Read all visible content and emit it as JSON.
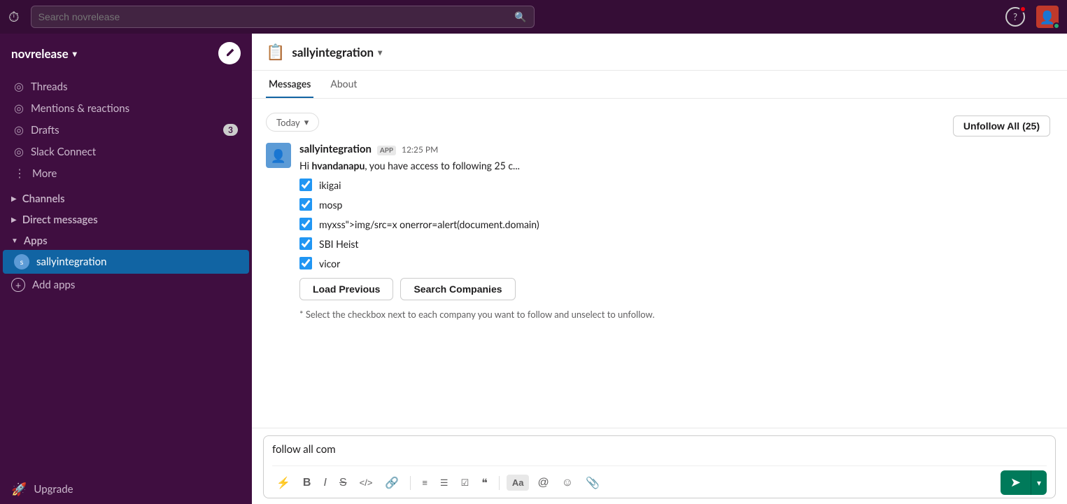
{
  "topbar": {
    "search_placeholder": "Search novrelease",
    "help_label": "?",
    "history_icon": "⏱"
  },
  "sidebar": {
    "workspace": "novrelease",
    "nav_items": [
      {
        "id": "threads",
        "icon": "◎",
        "label": "Threads"
      },
      {
        "id": "mentions",
        "icon": "◎",
        "label": "Mentions & reactions"
      },
      {
        "id": "drafts",
        "icon": "◎",
        "label": "Drafts",
        "badge": "3"
      },
      {
        "id": "slack-connect",
        "icon": "◎",
        "label": "Slack Connect"
      },
      {
        "id": "more",
        "icon": "⋮",
        "label": "More"
      }
    ],
    "channels_label": "Channels",
    "direct_messages_label": "Direct messages",
    "apps_label": "Apps",
    "apps": [
      {
        "id": "sallyintegration",
        "label": "sallyintegration",
        "active": true
      }
    ],
    "add_apps_label": "Add apps",
    "upgrade_label": "Upgrade"
  },
  "chat": {
    "channel_icon": "📋",
    "channel_name": "sallyintegration",
    "tabs": [
      {
        "id": "messages",
        "label": "Messages",
        "active": true
      },
      {
        "id": "about",
        "label": "About",
        "active": false
      }
    ],
    "message": {
      "sender": "sallyintegration",
      "app_badge": "APP",
      "time": "12:25 PM",
      "intro": "Hi ",
      "bold_name": "hvandanapu",
      "intro_rest": ", you have access to following 25 c...",
      "checklist": [
        {
          "id": "ikigai",
          "label": "ikigai",
          "checked": true
        },
        {
          "id": "mosp",
          "label": "mosp",
          "checked": true
        },
        {
          "id": "myxss",
          "label": "myxss\">img/src=x onerror=alert(document.domain)",
          "checked": true
        },
        {
          "id": "sbi-heist",
          "label": "SBI Heist",
          "checked": true
        },
        {
          "id": "vicor",
          "label": "vicor",
          "checked": true
        }
      ],
      "load_previous_label": "Load Previous",
      "search_companies_label": "Search Companies",
      "instruction": "* Select the checkbox next to each company you want to follow and unselect to unfollow."
    },
    "today_label": "Today",
    "unfollow_all_label": "Unfollow All (25)"
  },
  "composer": {
    "input_text": "follow all com",
    "toolbar": {
      "bold": "B",
      "italic": "I",
      "strikethrough": "S",
      "code": "</>",
      "link": "🔗",
      "ordered_list": "ol",
      "unordered_list": "ul",
      "checklist_icon": "☑",
      "quote": "❝",
      "aa_label": "Aa",
      "mention": "@",
      "emoji": "☺",
      "attachment": "📎"
    }
  }
}
